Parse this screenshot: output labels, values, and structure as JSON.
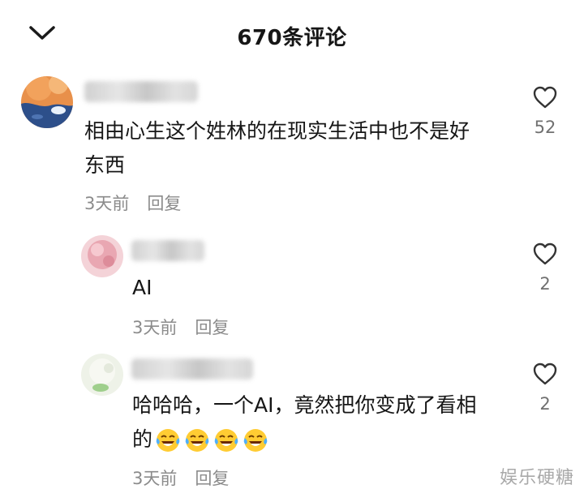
{
  "header": {
    "title": "670条评论"
  },
  "comments": [
    {
      "text_line1": "相由心生这个姓林的在现实生活中也不是好",
      "text_line2": "东西",
      "time": "3天前",
      "reply_label": "回复",
      "likes": "52"
    },
    {
      "text": "AI",
      "time": "3天前",
      "reply_label": "回复",
      "likes": "2"
    },
    {
      "text_line1": "哈哈哈，一个AI，竟然把你变成了看相",
      "text_line2": "的",
      "emoji_name": "tears-of-joy-emoji",
      "time": "3天前",
      "reply_label": "回复",
      "likes": "2"
    }
  ],
  "watermark": "娱乐硬糖",
  "colors": {
    "text": "#161616",
    "meta": "#8b8b8b",
    "icon": "#333333"
  },
  "icons": {
    "back": "chevron-down-icon",
    "like": "heart-outline-icon"
  }
}
